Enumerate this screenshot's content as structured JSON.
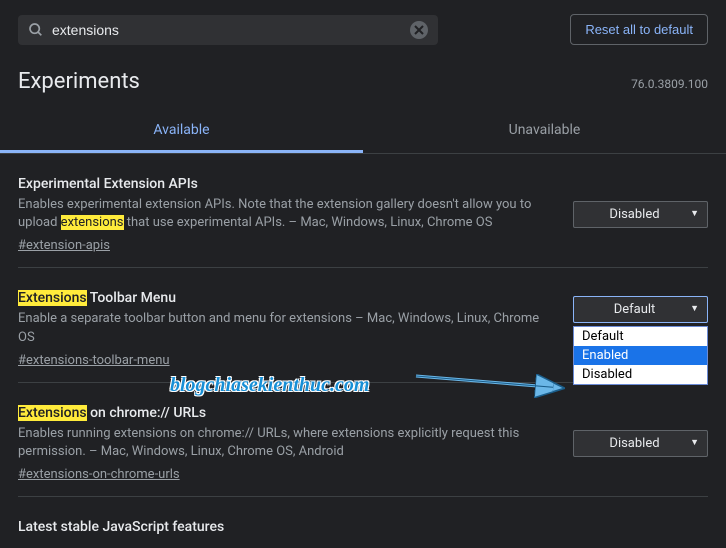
{
  "search": {
    "value": "extensions"
  },
  "reset_label": "Reset all to default",
  "page_title": "Experiments",
  "version": "76.0.3809.100",
  "tabs": {
    "available": "Available",
    "unavailable": "Unavailable"
  },
  "flags": {
    "f1": {
      "title_pre": "Experimental Extension APIs",
      "desc_pre": "Enables experimental extension APIs. Note that the extension gallery doesn't allow you to upload ",
      "desc_hl": "extensions",
      "desc_post": " that use experimental APIs. – Mac, Windows, Linux, Chrome OS",
      "link": "#extension-apis",
      "select": "Disabled"
    },
    "f2": {
      "title_hl": "Extensions",
      "title_post": " Toolbar Menu",
      "desc": "Enable a separate toolbar button and menu for extensions – Mac, Windows, Linux, Chrome OS",
      "link": "#extensions-toolbar-menu",
      "select": "Default",
      "options": {
        "o1": "Default",
        "o2": "Enabled",
        "o3": "Disabled"
      }
    },
    "f3": {
      "title_hl": "Extensions",
      "title_post": " on chrome:// URLs",
      "desc": "Enables running extensions on chrome:// URLs, where extensions explicitly request this permission. – Mac, Windows, Linux, Chrome OS, Android",
      "link": "#extensions-on-chrome-urls",
      "select": "Disabled"
    },
    "f4": {
      "title": "Latest stable JavaScript features"
    }
  },
  "watermark": "blogchiasekienthuc.com"
}
